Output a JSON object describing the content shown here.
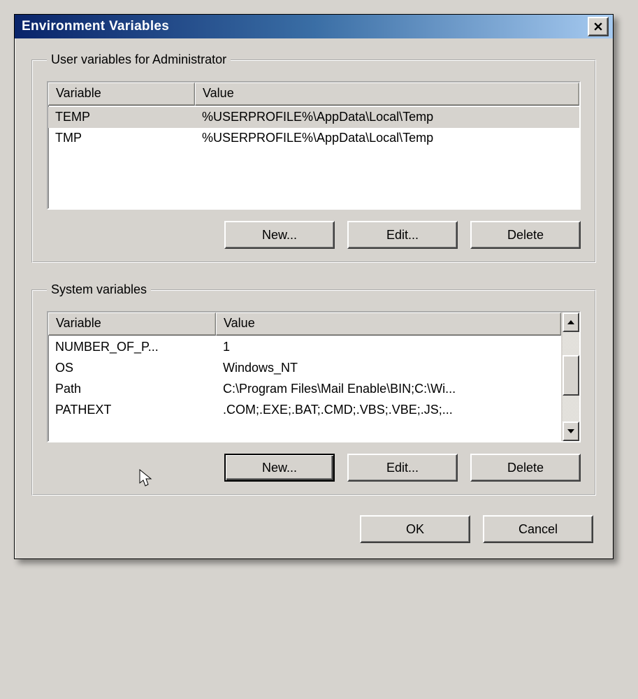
{
  "window": {
    "title": "Environment Variables"
  },
  "userGroup": {
    "legend": "User variables for Administrator",
    "headers": {
      "variable": "Variable",
      "value": "Value"
    },
    "rows": [
      {
        "variable": "TEMP",
        "value": "%USERPROFILE%\\AppData\\Local\\Temp",
        "selected": true
      },
      {
        "variable": "TMP",
        "value": "%USERPROFILE%\\AppData\\Local\\Temp"
      }
    ],
    "buttons": {
      "new": "New...",
      "edit": "Edit...",
      "delete": "Delete"
    }
  },
  "systemGroup": {
    "legend": "System variables",
    "headers": {
      "variable": "Variable",
      "value": "Value"
    },
    "rows": [
      {
        "variable": "NUMBER_OF_P...",
        "value": "1"
      },
      {
        "variable": "OS",
        "value": "Windows_NT"
      },
      {
        "variable": "Path",
        "value": "C:\\Program Files\\Mail Enable\\BIN;C:\\Wi..."
      },
      {
        "variable": "PATHEXT",
        "value": ".COM;.EXE;.BAT;.CMD;.VBS;.VBE;.JS;..."
      }
    ],
    "buttons": {
      "new": "New...",
      "edit": "Edit...",
      "delete": "Delete"
    }
  },
  "dialogButtons": {
    "ok": "OK",
    "cancel": "Cancel"
  }
}
